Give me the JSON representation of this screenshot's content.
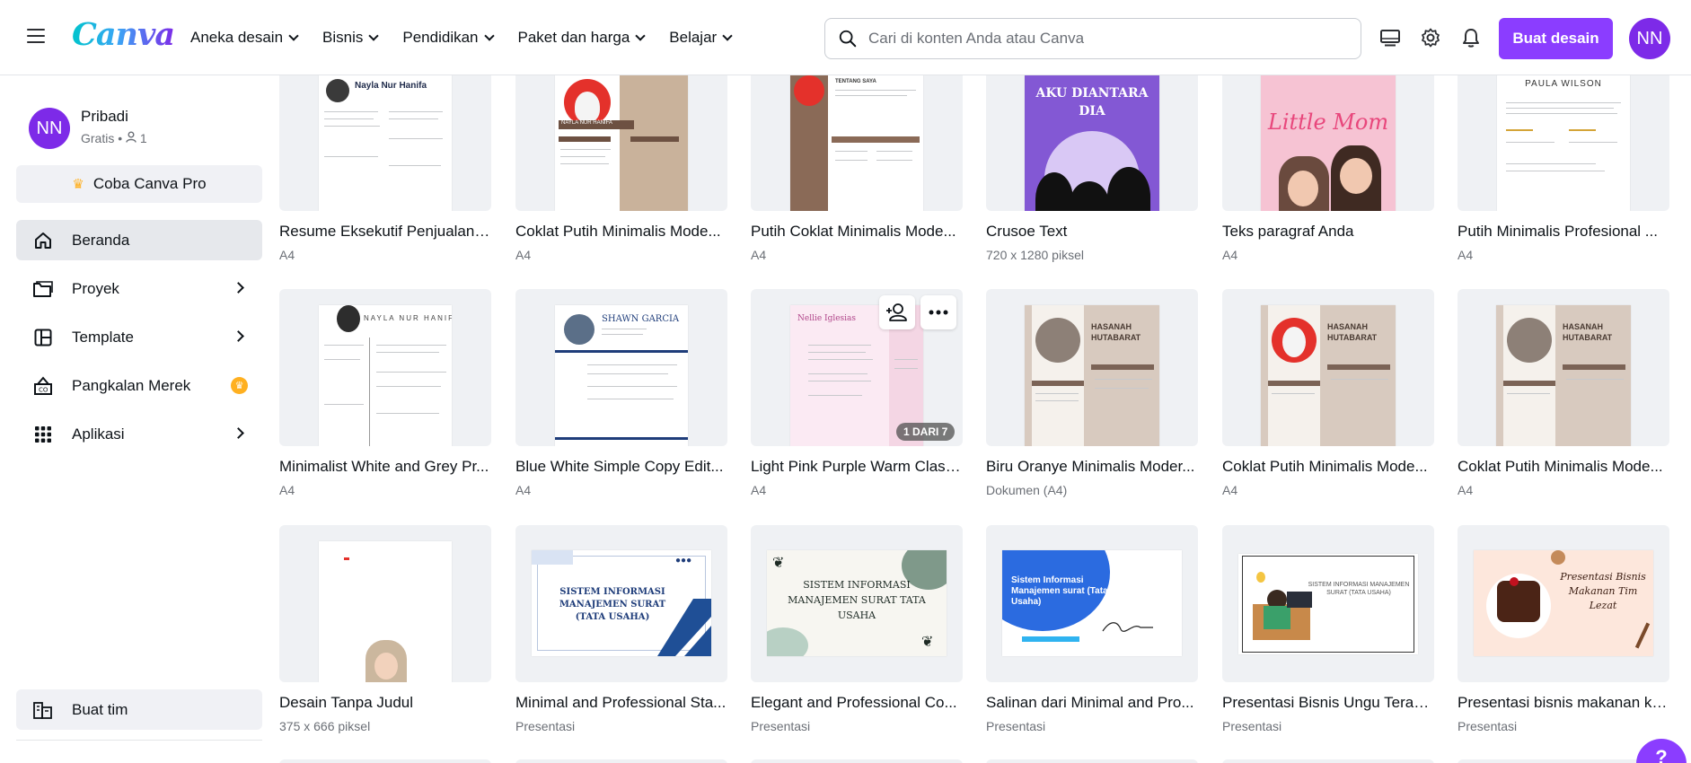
{
  "header": {
    "logo": "Canva",
    "nav": [
      "Aneka desain",
      "Bisnis",
      "Pendidikan",
      "Paket dan harga",
      "Belajar"
    ],
    "search_placeholder": "Cari di konten Anda atau Canva",
    "create_button": "Buat desain",
    "avatar_initials": "NN"
  },
  "sidebar": {
    "account_initials": "NN",
    "account_name": "Pribadi",
    "account_plan": "Gratis",
    "account_members": "1",
    "pro_button": "Coba Canva Pro",
    "items": [
      {
        "label": "Beranda",
        "icon": "home-icon"
      },
      {
        "label": "Proyek",
        "icon": "folder-icon"
      },
      {
        "label": "Template",
        "icon": "template-icon"
      },
      {
        "label": "Pangkalan Merek",
        "icon": "brand-kit-icon"
      },
      {
        "label": "Aplikasi",
        "icon": "apps-icon"
      }
    ],
    "team_button": "Buat tim"
  },
  "designs": [
    {
      "title": "Resume Eksekutif Penjualan ...",
      "sub": "A4",
      "thumb_text": "Nayla Nur Hanifa"
    },
    {
      "title": "Coklat Putih Minimalis Mode...",
      "sub": "A4",
      "thumb_text": "NAYLA NUR HANIFA"
    },
    {
      "title": "Putih Coklat Minimalis Mode...",
      "sub": "A4",
      "thumb_text": "TENTANG SAYA"
    },
    {
      "title": "Crusoe Text",
      "sub": "720 x 1280 piksel",
      "thumb_text": "AKU DIANTARA DIA"
    },
    {
      "title": "Teks paragraf Anda",
      "sub": "A4",
      "thumb_text": "Little Mom"
    },
    {
      "title": "Putih Minimalis Profesional ...",
      "sub": "A4",
      "thumb_text": "PAULA WILSON"
    },
    {
      "title": "Minimalist White and Grey Pr...",
      "sub": "A4",
      "thumb_text": "NAYLA NUR HANIFA"
    },
    {
      "title": "Blue White Simple Copy Edit...",
      "sub": "A4",
      "thumb_text": "SHAWN GARCIA"
    },
    {
      "title": "Light Pink Purple Warm Class...",
      "sub": "A4",
      "thumb_text": "Nellie Iglesias",
      "page_badge": "1 DARI 7"
    },
    {
      "title": "Biru Oranye Minimalis Moder...",
      "sub": "Dokumen (A4)",
      "thumb_text": "HASANAH HUTABARAT"
    },
    {
      "title": "Coklat Putih Minimalis Mode...",
      "sub": "A4",
      "thumb_text": "HASANAH HUTABARAT"
    },
    {
      "title": "Coklat Putih Minimalis Mode...",
      "sub": "A4",
      "thumb_text": "HASANAH HUTABARAT"
    },
    {
      "title": "Desain Tanpa Judul",
      "sub": "375 x 666 piksel",
      "thumb_text": ""
    },
    {
      "title": "Minimal and Professional Sta...",
      "sub": "Presentasi",
      "thumb_text": "SISTEM INFORMASI MANAJEMEN SURAT (TATA USAHA)"
    },
    {
      "title": "Elegant and Professional Co...",
      "sub": "Presentasi",
      "thumb_text": "SISTEM INFORMASI MANAJEMEN SURAT TATA USAHA"
    },
    {
      "title": "Salinan dari Minimal and Pro...",
      "sub": "Presentasi",
      "thumb_text": "Sistem Informasi Manajemen surat (Tata Usaha)"
    },
    {
      "title": "Presentasi Bisnis Ungu Teran...",
      "sub": "Presentasi",
      "thumb_text": "SISTEM INFORMASI MANAJEMEN SURAT (TATA USAHA)"
    },
    {
      "title": "Presentasi bisnis makanan ku...",
      "sub": "Presentasi",
      "thumb_text": "Presentasi Bisnis Makanan Tim Lezat"
    }
  ],
  "help_label": "?",
  "colors": {
    "accent": "#8b3dff",
    "thumb_bg": "#eff1f4",
    "active_nav": "#e6e8ec"
  }
}
